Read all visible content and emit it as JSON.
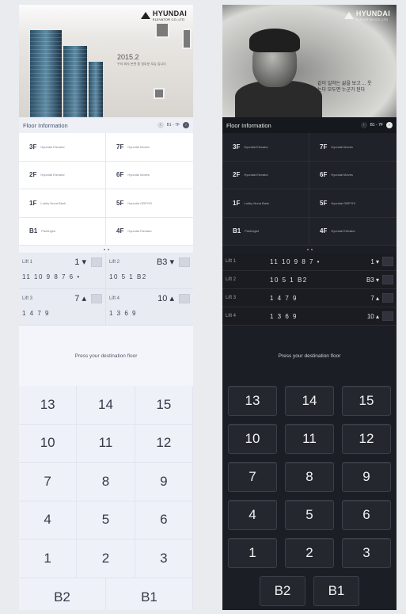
{
  "brand": {
    "name": "HYUNDAI",
    "sub": "ELEVATOR CO.,LTD"
  },
  "light_panel": {
    "hero": {
      "title": "2015.2",
      "text": "우리 회사 본관 중 일부분 모습 입니다"
    },
    "floor_info": {
      "title": "Floor Information",
      "page": "B1 - 7F",
      "rows": [
        {
          "floor": "3F",
          "desc": "Hyundai Elevator"
        },
        {
          "floor": "7F",
          "desc": "Hyundai Moves"
        },
        {
          "floor": "2F",
          "desc": "Hyundai Elevator"
        },
        {
          "floor": "6F",
          "desc": "Hyundai Moves"
        },
        {
          "floor": "1F",
          "desc": "Lobby Nuna Bank"
        },
        {
          "floor": "5F",
          "desc": "Hyundai GBPYIS"
        },
        {
          "floor": "B1",
          "desc": "Parkinglot"
        },
        {
          "floor": "4F",
          "desc": "Hyundai Elevator"
        }
      ]
    },
    "lifts": [
      {
        "name": "Lift 1",
        "current": "1 ▾",
        "queue": "11 10 9 8 7 6 •"
      },
      {
        "name": "Lift 2",
        "current": "B3 ▾",
        "queue": "10 5 1 B2"
      },
      {
        "name": "Lift 3",
        "current": "7 ▴",
        "queue": "1 4 7 9"
      },
      {
        "name": "Lift 4",
        "current": "10 ▴",
        "queue": "1 3 6 9"
      }
    ],
    "prompt": "Press your destination floor",
    "keys": [
      "13",
      "14",
      "15",
      "10",
      "11",
      "12",
      "7",
      "8",
      "9",
      "4",
      "5",
      "6",
      "1",
      "2",
      "3"
    ],
    "bottom_keys": [
      "B2",
      "B1"
    ]
  },
  "dark_panel": {
    "floor_info": {
      "title": "Floor Information",
      "page": "B1 - 7F",
      "rows": [
        {
          "floor": "3F",
          "desc": "Hyundai Elevator"
        },
        {
          "floor": "7F",
          "desc": "Hyundai Moves"
        },
        {
          "floor": "2F",
          "desc": "Hyundai Elevator"
        },
        {
          "floor": "6F",
          "desc": "Hyundai Moves"
        },
        {
          "floor": "1F",
          "desc": "Lobby Nuna Bank"
        },
        {
          "floor": "5F",
          "desc": "Hyundai GBPYIS"
        },
        {
          "floor": "B1",
          "desc": "Parkinglot"
        },
        {
          "floor": "4F",
          "desc": "Hyundai Elevator"
        }
      ]
    },
    "hero": {
      "text": "같이 일하는 삶을 보고 ... 웃는다 모두면 누군가 된다"
    },
    "lifts": [
      {
        "name": "Lift 1",
        "queue": "11 10 9 8 7 •",
        "current": "1 ▾"
      },
      {
        "name": "Lift 2",
        "queue": "10 5 1 B2",
        "current": "B3 ▾"
      },
      {
        "name": "Lift 3",
        "queue": "1 4 7 9",
        "current": "7 ▴"
      },
      {
        "name": "Lift 4",
        "queue": "1 3 6 9",
        "current": "10 ▴"
      }
    ],
    "prompt": "Press your destination floor",
    "keys": [
      "13",
      "14",
      "15",
      "10",
      "11",
      "12",
      "7",
      "8",
      "9",
      "4",
      "5",
      "6",
      "1",
      "2",
      "3"
    ],
    "bottom_keys": [
      "B2",
      "B1"
    ]
  },
  "icons": {
    "prev": "chevron-left-icon",
    "next": "chevron-right-icon",
    "logo": "hyundai-triangle-icon"
  }
}
